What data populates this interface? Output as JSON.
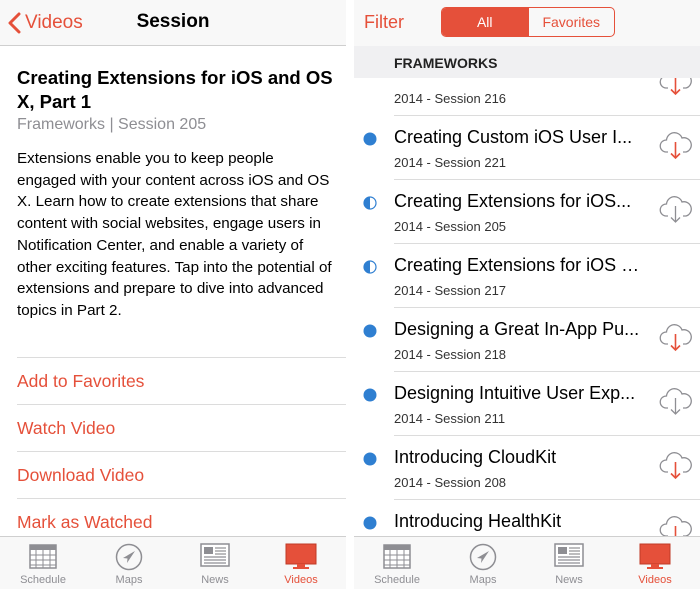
{
  "left": {
    "nav": {
      "back_label": "Videos",
      "title": "Session"
    },
    "session": {
      "title": "Creating Extensions for iOS and OS X, Part 1",
      "subtitle": "Frameworks | Session 205",
      "description": "Extensions enable you to keep people engaged with your content across iOS and OS X. Learn how to create extensions that share content with social websites, engage users in Notification Center, and enable a variety of other exciting features. Tap into the potential of extensions and prepare to dive into advanced topics in Part 2."
    },
    "actions": [
      "Add to Favorites",
      "Watch Video",
      "Download Video",
      "Mark as Watched"
    ]
  },
  "tabs": [
    {
      "label": "Schedule",
      "icon": "calendar-icon"
    },
    {
      "label": "Maps",
      "icon": "location-arrow-icon"
    },
    {
      "label": "News",
      "icon": "newspaper-icon"
    },
    {
      "label": "Videos",
      "icon": "video-screen-icon",
      "active": true
    }
  ],
  "right": {
    "nav": {
      "filter_label": "Filter",
      "segments": [
        "All",
        "Favorites"
      ],
      "selected_segment": "All"
    },
    "section_header": "FRAMEWORKS",
    "rows": [
      {
        "title": "",
        "subtitle": "2014 - Session 216",
        "status": "none"
      },
      {
        "title": "Creating Custom iOS User I...",
        "subtitle": "2014 - Session 221",
        "status": "unwatched"
      },
      {
        "title": "Creating Extensions for iOS...",
        "subtitle": "2014 - Session 205",
        "status": "partial"
      },
      {
        "title": "Creating Extensions for iOS and...",
        "subtitle": "2014 - Session 217",
        "status": "partial"
      },
      {
        "title": "Designing a Great In-App Pu...",
        "subtitle": "2014 - Session 218",
        "status": "unwatched"
      },
      {
        "title": "Designing Intuitive User Exp...",
        "subtitle": "2014 - Session 211",
        "status": "unwatched"
      },
      {
        "title": "Introducing CloudKit",
        "subtitle": "2014 - Session 208",
        "status": "unwatched"
      },
      {
        "title": "Introducing HealthKit",
        "subtitle": "",
        "status": "unwatched"
      }
    ]
  },
  "colors": {
    "accent": "#e5503a",
    "dot": "#2f7fd1",
    "tab_inactive": "#8e8e93"
  }
}
